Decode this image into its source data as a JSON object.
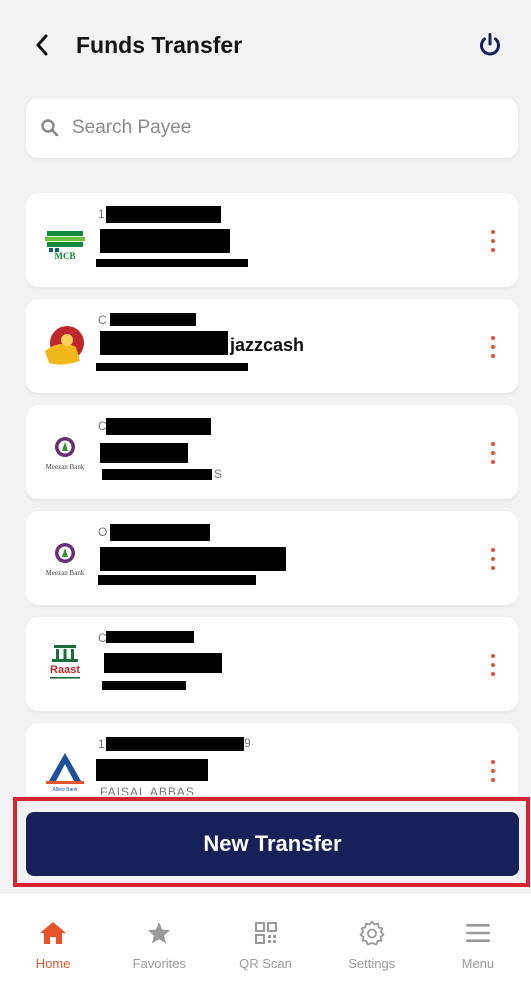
{
  "header": {
    "title": "Funds Transfer"
  },
  "search": {
    "placeholder": "Search Payee"
  },
  "payees": [
    {
      "bank_logo_text": "MCB",
      "line1": "1",
      "line2": "",
      "line3": "",
      "suffix": ""
    },
    {
      "bank_logo_text": "",
      "line1": "C",
      "line2": "jazzcash",
      "line3": "",
      "suffix": ""
    },
    {
      "bank_logo_text": "Meezan Bank",
      "line1": "C",
      "line2": "",
      "line3": "S",
      "suffix": ""
    },
    {
      "bank_logo_text": "Meezan Bank",
      "line1": "O",
      "line2": "",
      "line3": "",
      "suffix": ""
    },
    {
      "bank_logo_text": "Raast",
      "line1": "C",
      "line2": "",
      "line3": "",
      "suffix": ""
    },
    {
      "bank_logo_text": "Allied Bank",
      "line1": "1",
      "line2": "",
      "line3": "FAISAL ABBAS",
      "suffix": "9"
    }
  ],
  "cta": {
    "label": "New Transfer"
  },
  "bottom_nav": [
    {
      "label": "Home",
      "icon": "home-icon",
      "active": true
    },
    {
      "label": "Favorites",
      "icon": "star-icon",
      "active": false
    },
    {
      "label": "QR Scan",
      "icon": "qr-icon",
      "active": false
    },
    {
      "label": "Settings",
      "icon": "gear-icon",
      "active": false
    },
    {
      "label": "Menu",
      "icon": "menu-icon",
      "active": false
    }
  ],
  "colors": {
    "accent": "#e8542a",
    "primary": "#16215a",
    "highlight": "#d9242f"
  }
}
